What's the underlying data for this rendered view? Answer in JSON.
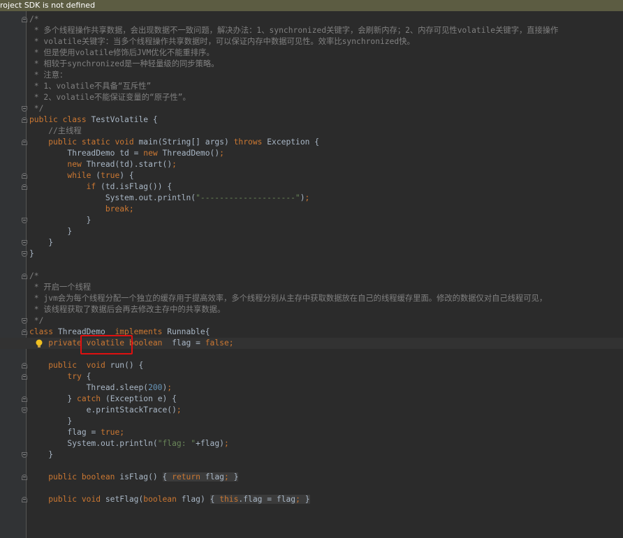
{
  "banner": {
    "text": "roject SDK is not defined"
  },
  "colors": {
    "background": "#2b2b2b",
    "keyword": "#cc7832",
    "comment": "#808080",
    "string": "#6a8759",
    "number": "#6897bb",
    "plain": "#a9b7c6",
    "highlight_box": "#e01010",
    "banner": "#5c5c42"
  },
  "icons": {
    "intention": "lightbulb-icon",
    "fold": "fold-marker-icon"
  },
  "lines": [
    "/*",
    " * 多个线程操作共享数据，会出现数据不一致问题，解决办法：1、synchronized关键字，会刷新内存；2、内存可见性volatile关键字，直接操作",
    " * volatile关键字：当多个线程操作共享数据时，可以保证内存中数据可见性。效率比synchronized快。",
    " * 但是使用volatile修饰后JVM优化不能重排序。",
    " * 相较于synchronized是一种轻量级的同步策略。",
    " * 注意：",
    " * 1、volatile不具备“互斥性”",
    " * 2、volatile不能保证变量的“原子性”。",
    " */",
    "public class TestVolatile {",
    "    //主线程",
    "    public static void main(String[] args) throws Exception {",
    "        ThreadDemo td = new ThreadDemo();",
    "        new Thread(td).start();",
    "        while (true) {",
    "            if (td.isFlag()) {",
    "                System.out.println(\"--------------------\");",
    "                break;",
    "            }",
    "        }",
    "    }",
    "}",
    "",
    "/*",
    " * 开启一个线程",
    " * jvm会为每个线程分配一个独立的缓存用于提高效率，多个线程分别从主存中获取数据放在自己的线程缓存里面。修改的数据仅对自己线程可见，",
    " * 该线程获取了数据后会再去修改主存中的共享数据。",
    " */",
    "class ThreadDemo  implements Runnable{",
    "    private volatile boolean  flag = false;",
    "",
    "    public  void run() {",
    "        try {",
    "            Thread.sleep(200);",
    "        } catch (Exception e) {",
    "            e.printStackTrace();",
    "        }",
    "        flag = true;",
    "        System.out.println(\"flag: \"+flag);",
    "    }",
    "",
    "    public boolean isFlag() { return flag; }",
    "",
    "    public void setFlag(boolean flag) { this.flag = flag; }"
  ]
}
